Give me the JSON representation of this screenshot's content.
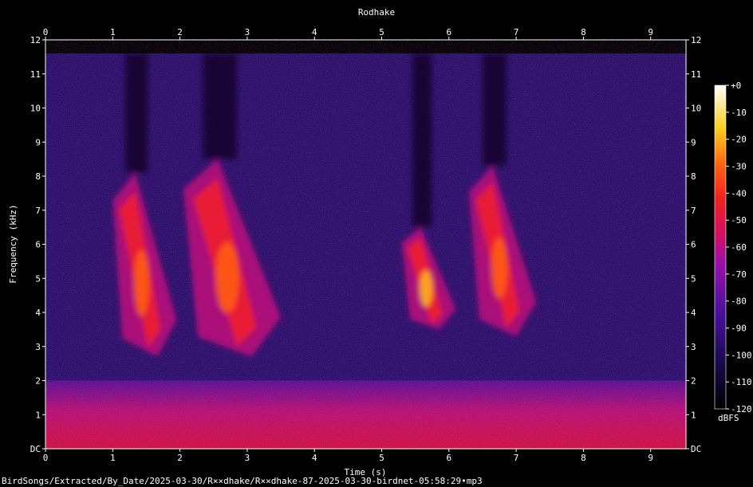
{
  "chart_data": {
    "type": "heatmap",
    "title": "Rodhake",
    "xlabel": "Time (s)",
    "ylabel": "Frequency (kHz)",
    "xlim": [
      0,
      9.5
    ],
    "ylim": [
      0,
      12
    ],
    "x_ticks": [
      "0",
      "1",
      "2",
      "3",
      "4",
      "5",
      "6",
      "7",
      "8",
      "9"
    ],
    "y_ticks": [
      "DC",
      "1",
      "2",
      "3",
      "4",
      "5",
      "6",
      "7",
      "8",
      "9",
      "10",
      "11",
      "12"
    ],
    "colorbar": {
      "label": "dBFS",
      "range": [
        -120,
        0
      ],
      "ticks": [
        "+0",
        "-10",
        "-20",
        "-30",
        "-40",
        "-50",
        "-60",
        "-70",
        "-80",
        "-90",
        "-100",
        "-110",
        "-120"
      ]
    },
    "calls": [
      {
        "t_start": 1.0,
        "t_end": 1.95,
        "f_low": 2.7,
        "f_high": 8.1,
        "peak_dbfs": -20
      },
      {
        "t_start": 2.05,
        "t_end": 3.5,
        "f_low": 2.7,
        "f_high": 8.5,
        "peak_dbfs": -25
      },
      {
        "t_start": 5.3,
        "t_end": 6.1,
        "f_low": 3.5,
        "f_high": 6.5,
        "peak_dbfs": -15
      },
      {
        "t_start": 6.3,
        "t_end": 7.3,
        "f_low": 3.3,
        "f_high": 8.3,
        "peak_dbfs": -25
      }
    ],
    "background_dbfs": -100,
    "low_band": {
      "f_low": 0,
      "f_high": 2,
      "level_dbfs": -60
    }
  },
  "caption": "BirdSongs/Extracted/By_Date/2025-03-30/R××dhake/R××dhake-87-2025-03-30-birdnet-05:58:29•mp3"
}
